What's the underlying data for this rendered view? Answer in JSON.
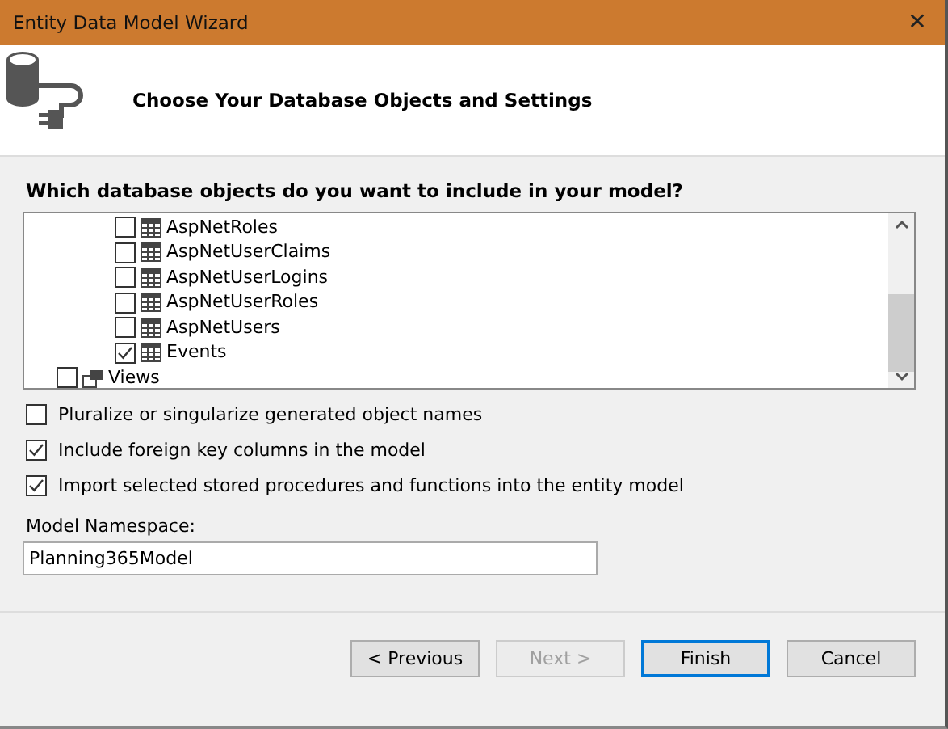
{
  "window": {
    "title": "Entity Data Model Wizard",
    "close": "✕"
  },
  "header": {
    "title": "Choose Your Database Objects and Settings"
  },
  "tree": {
    "label": "Which database objects do you want to include in your model?",
    "items": [
      {
        "label": "AspNetRoles",
        "kind": "table",
        "checked": false
      },
      {
        "label": "AspNetUserClaims",
        "kind": "table",
        "checked": false
      },
      {
        "label": "AspNetUserLogins",
        "kind": "table",
        "checked": false
      },
      {
        "label": "AspNetUserRoles",
        "kind": "table",
        "checked": false
      },
      {
        "label": "AspNetUsers",
        "kind": "table",
        "checked": false
      },
      {
        "label": "Events",
        "kind": "table",
        "checked": true
      },
      {
        "label": "Views",
        "kind": "folder",
        "checked": false
      }
    ]
  },
  "options": [
    {
      "label": "Pluralize or singularize generated object names",
      "checked": false
    },
    {
      "label": "Include foreign key columns in the model",
      "checked": true
    },
    {
      "label": "Import selected stored procedures and functions into the entity model",
      "checked": true
    }
  ],
  "namespace": {
    "label": "Model Namespace:",
    "value": "Planning365Model"
  },
  "buttons": [
    {
      "label": "< Previous",
      "disabled": false,
      "default": false
    },
    {
      "label": "Next >",
      "disabled": true,
      "default": false
    },
    {
      "label": "Finish",
      "disabled": false,
      "default": true
    },
    {
      "label": "Cancel",
      "disabled": false,
      "default": false
    }
  ]
}
